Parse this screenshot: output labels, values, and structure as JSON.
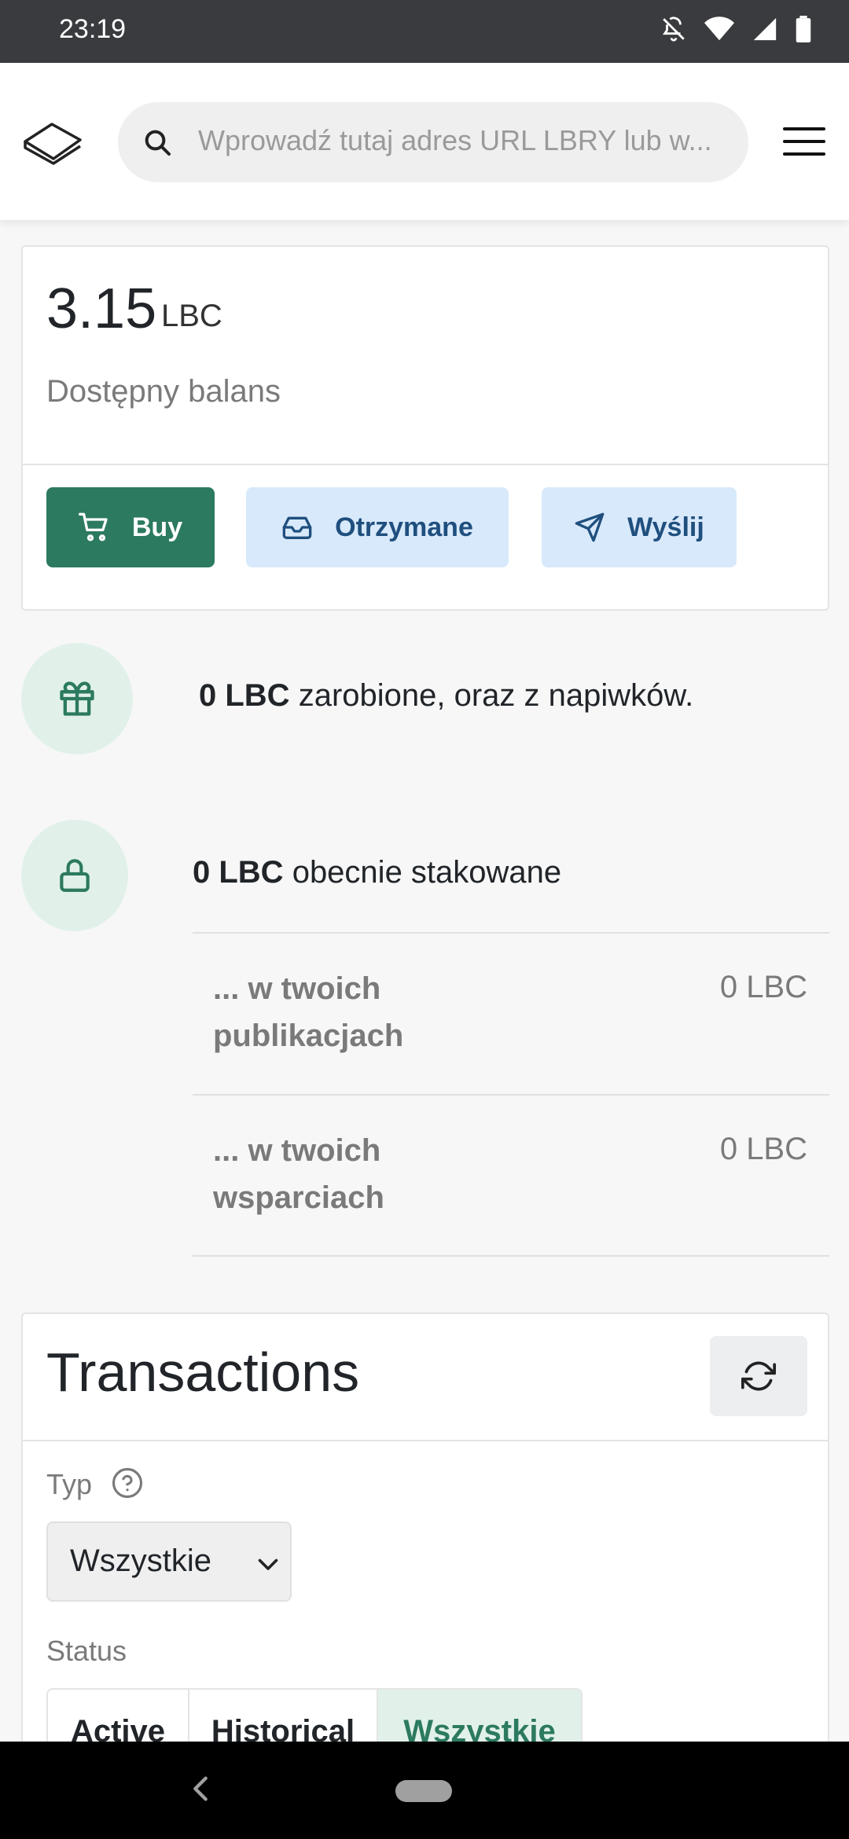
{
  "status_bar": {
    "time": "23:19",
    "icons": [
      "bell-off-icon",
      "wifi-icon",
      "signal-icon",
      "battery-icon"
    ]
  },
  "header": {
    "search_placeholder": "Wprowadź tutaj adres URL LBRY lub w...",
    "icons": [
      "lbry-logo-icon",
      "search-icon",
      "hamburger-menu-icon"
    ]
  },
  "balance": {
    "amount": "3.15",
    "unit": "LBC",
    "label": "Dostępny balans",
    "buttons": {
      "buy": "Buy",
      "receive": "Otrzymane",
      "send": "Wyślij"
    }
  },
  "earned": {
    "amount": "0 LBC",
    "text": " zarobione, oraz z napiwków."
  },
  "staked": {
    "amount": "0 LBC",
    "text": " obecnie stakowane",
    "rows": [
      {
        "label": "... w twoich publikacjach",
        "value": "0 LBC"
      },
      {
        "label": "... w twoich wsparciach",
        "value": "0 LBC"
      }
    ]
  },
  "transactions": {
    "title": "Transactions",
    "type_label": "Typ",
    "type_value": "Wszystkie",
    "status_label": "Status",
    "status_tabs": [
      "Active",
      "Historical",
      "Wszystkie"
    ],
    "selected_status": "Wszystkie"
  },
  "colors": {
    "accent_green": "#2c7a5f",
    "light_green": "#e1f1ea",
    "light_blue": "#d8e9fb",
    "blue_text": "#1f4f7e"
  }
}
